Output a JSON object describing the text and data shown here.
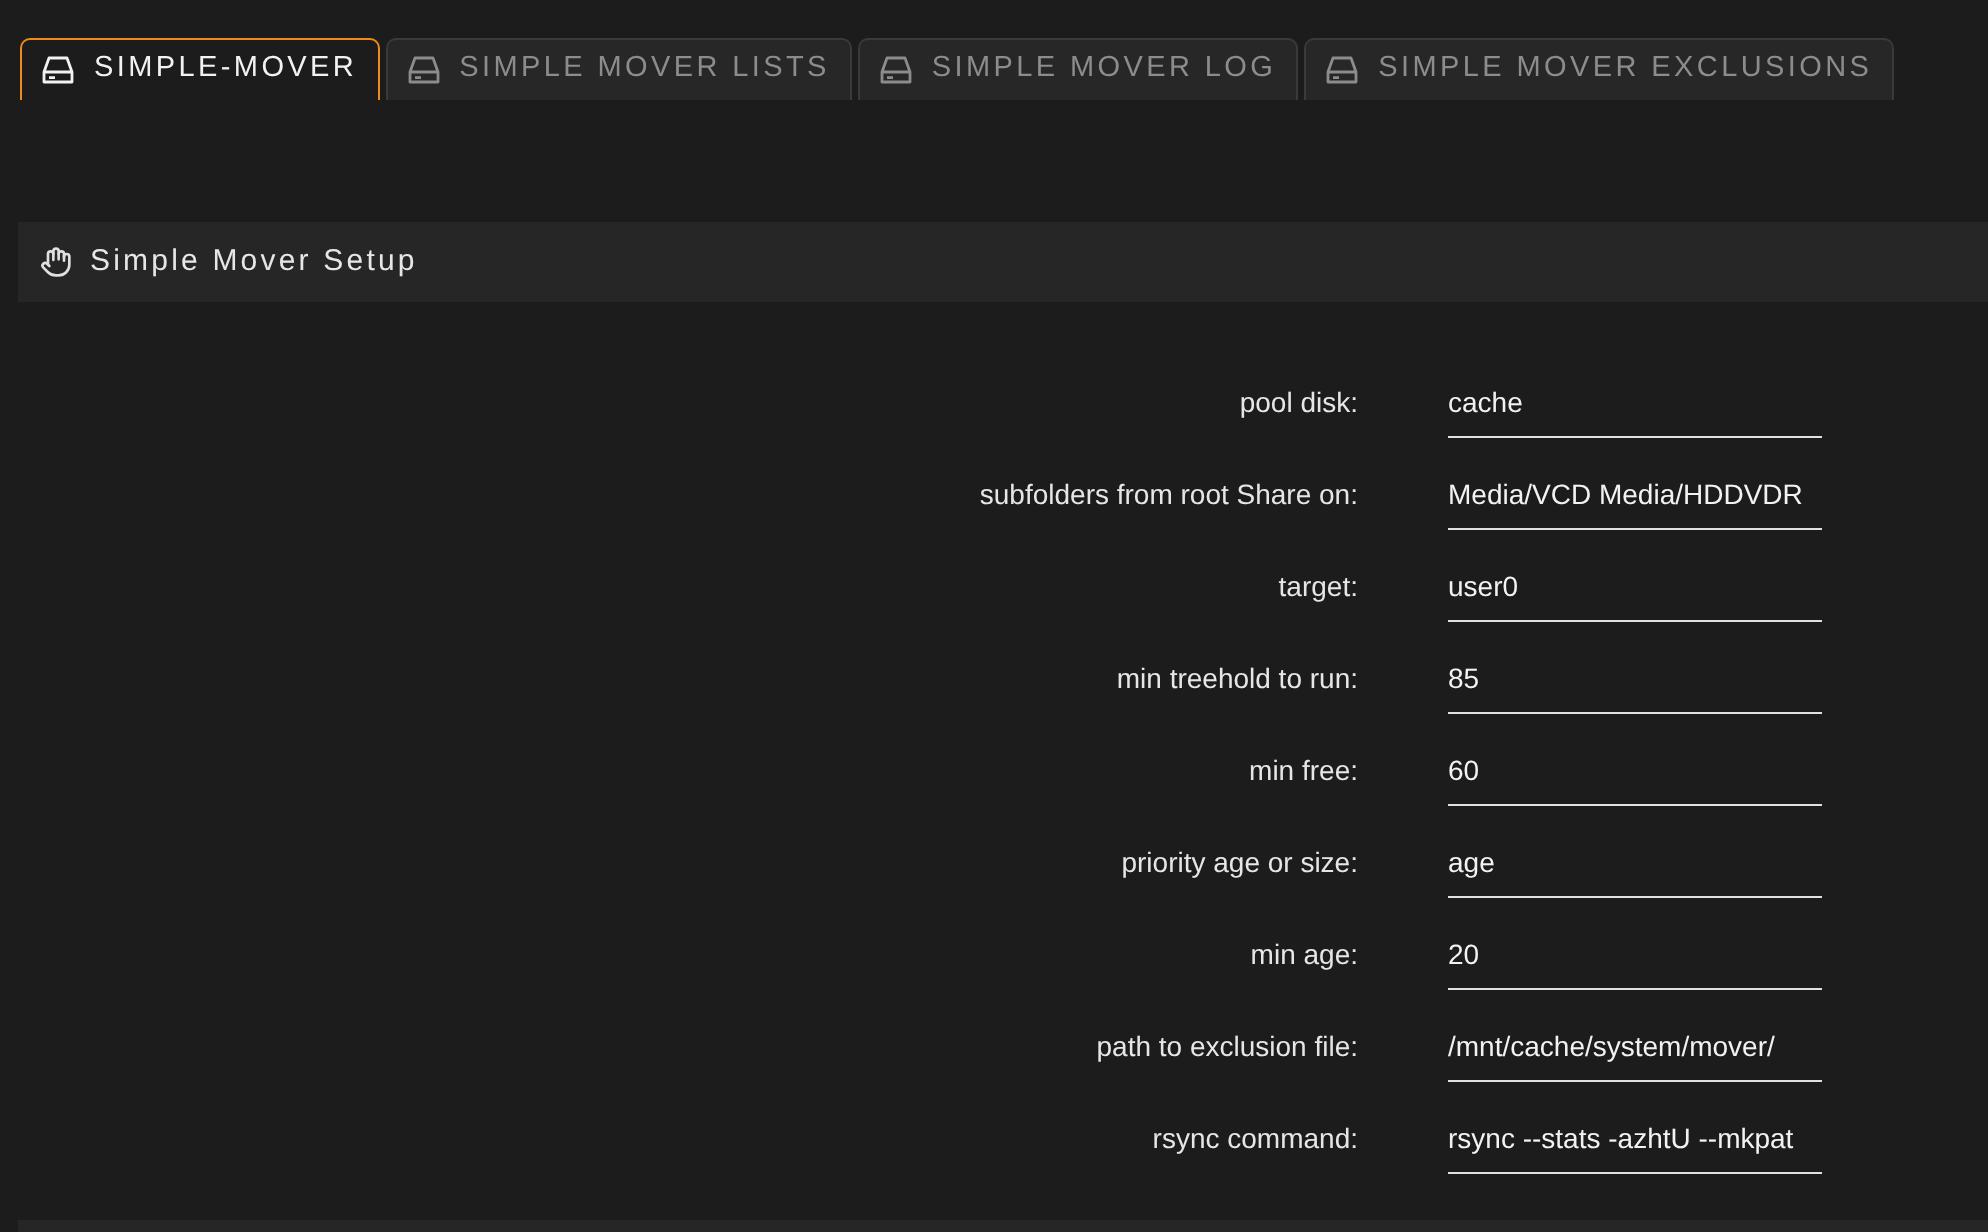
{
  "tabs": [
    {
      "label": "SIMPLE-MOVER",
      "selected": true
    },
    {
      "label": "SIMPLE MOVER LISTS",
      "selected": false
    },
    {
      "label": "SIMPLE MOVER LOG",
      "selected": false
    },
    {
      "label": "SIMPLE MOVER EXCLUSIONS",
      "selected": false
    }
  ],
  "section": {
    "title": "Simple Mover Setup"
  },
  "fields": [
    {
      "label": "pool disk:",
      "value": "cache"
    },
    {
      "label": "subfolders from root Share on:",
      "value": "Media/VCD Media/HDDVDR"
    },
    {
      "label": "target:",
      "value": "user0"
    },
    {
      "label": "min treehold to run:",
      "value": "85"
    },
    {
      "label": "min free:",
      "value": "60"
    },
    {
      "label": "priority age or size:",
      "value": "age"
    },
    {
      "label": "min age:",
      "value": "20"
    },
    {
      "label": "path to exclusion file:",
      "value": "/mnt/cache/system/mover/"
    },
    {
      "label": "rsync command:",
      "value": "rsync --stats -azhtU --mkpat"
    }
  ]
}
